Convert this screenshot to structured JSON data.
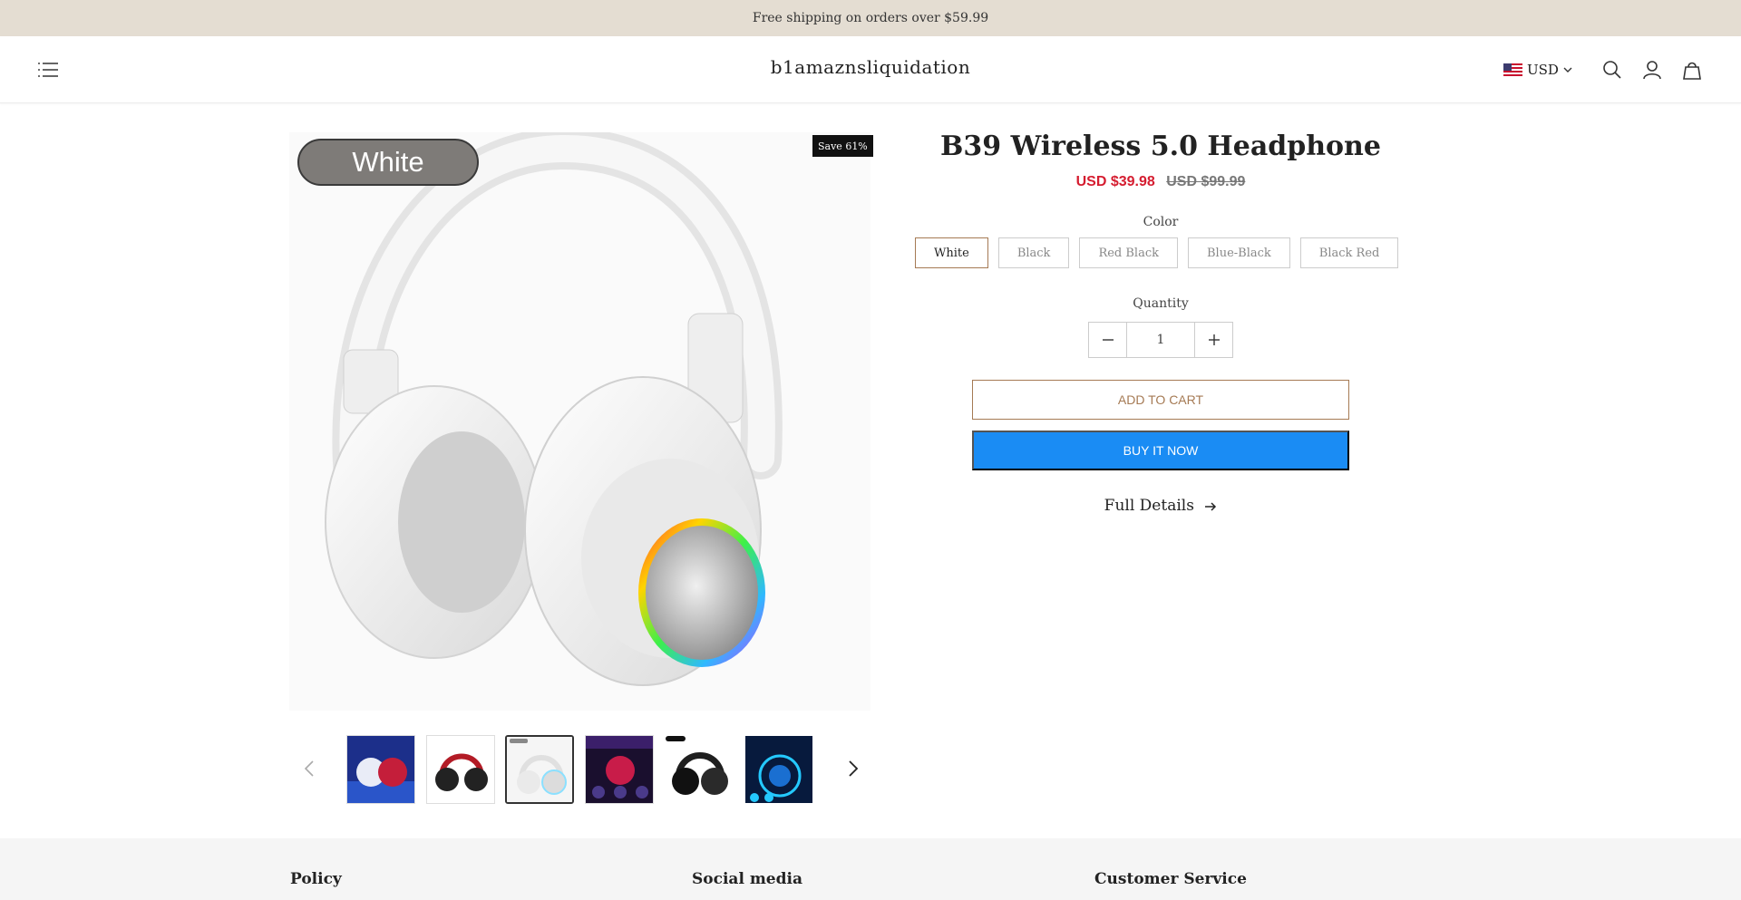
{
  "announcement": "Free shipping on orders over $59.99",
  "header": {
    "brand": "b1amaznsliquidation",
    "currency": "USD",
    "menu_icon": "hamburger-menu-icon",
    "search_icon": "search-icon",
    "account_icon": "account-icon",
    "cart_icon": "shopping-bag-icon"
  },
  "gallery": {
    "image_label": "White",
    "save_badge": "Save 61%",
    "thumbnail_count": 6,
    "active_thumbnail": 3
  },
  "product": {
    "title": "B39 Wireless 5.0 Headphone",
    "price": "USD $39.98",
    "compare_price": "USD $99.99",
    "color_label": "Color",
    "colors": [
      "White",
      "Black",
      "Red Black",
      "Blue-Black",
      "Black Red"
    ],
    "selected_color": "White",
    "quantity_label": "Quantity",
    "quantity": "1",
    "add_to_cart": "ADD TO CART",
    "buy_now": "BUY IT NOW",
    "full_details": "Full Details"
  },
  "footer": {
    "policy": "Policy",
    "social": "Social media",
    "service": "Customer Service"
  },
  "colors": {
    "announcement_bg": "#e4ddd2",
    "sale_price": "#d51d30",
    "accent": "#a57a54",
    "buy_button": "#1a8cf4"
  }
}
